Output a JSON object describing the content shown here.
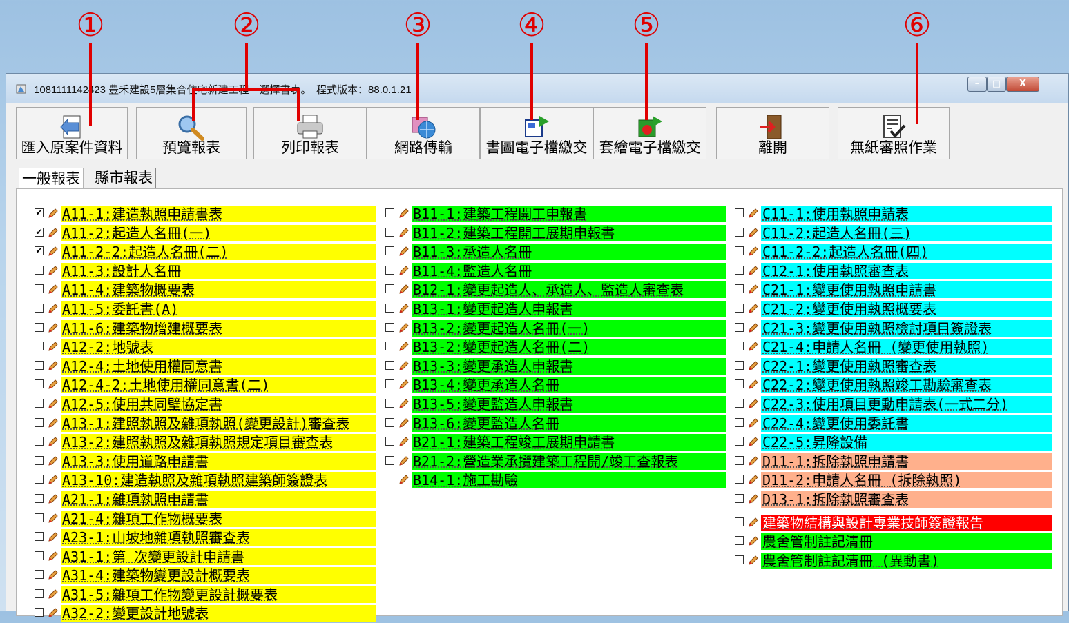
{
  "callouts": [
    "①",
    "②",
    "③",
    "④",
    "⑤",
    "⑥"
  ],
  "window": {
    "title": "1081111142423 豊禾建設5層集合住宅新建工程　選擇書表。　程式版本：88.0.1.21",
    "minimize": "–",
    "maximize": "□",
    "close": "X"
  },
  "toolbar": {
    "import_label": "匯入原案件資料",
    "preview_label": "預覽報表",
    "print_label": "列印報表",
    "network_label": "網路傳輸",
    "drawing_label": "書圖電子檔繳交",
    "overlay_label": "套繪電子檔繳交",
    "exit_label": "離開",
    "paperless_label": "無紙審照作業"
  },
  "tabs": [
    "一般報表",
    "縣市報表"
  ],
  "colors": {
    "yellow": "#ffff00",
    "green": "#00ff00",
    "cyan": "#00ffff",
    "salmon": "#ffb08c",
    "red": "#ff0000"
  },
  "columns": [
    {
      "items": [
        {
          "label": "A11-1:建造執照申請書表",
          "checked": true,
          "color": "yellow",
          "checkbox": true
        },
        {
          "label": "A11-2:起造人名冊(一)",
          "checked": true,
          "color": "yellow",
          "checkbox": true
        },
        {
          "label": "A11-2-2:起造人名冊(二)",
          "checked": true,
          "color": "yellow",
          "checkbox": true
        },
        {
          "label": "A11-3:設計人名冊",
          "checked": false,
          "color": "yellow",
          "checkbox": true
        },
        {
          "label": "A11-4:建築物概要表",
          "checked": false,
          "color": "yellow",
          "checkbox": true
        },
        {
          "label": "A11-5:委託書(A)",
          "checked": false,
          "color": "yellow",
          "checkbox": true
        },
        {
          "label": "A11-6:建築物增建概要表",
          "checked": false,
          "color": "yellow",
          "checkbox": true
        },
        {
          "label": "A12-2:地號表",
          "checked": false,
          "color": "yellow",
          "checkbox": true
        },
        {
          "label": "A12-4:土地使用權同意書",
          "checked": false,
          "color": "yellow",
          "checkbox": true
        },
        {
          "label": "A12-4-2:土地使用權同意書(二)",
          "checked": false,
          "color": "yellow",
          "checkbox": true
        },
        {
          "label": "A12-5:使用共同壁協定書",
          "checked": false,
          "color": "yellow",
          "checkbox": true
        },
        {
          "label": "A13-1:建照執照及雜項執照(變更設計)審查表",
          "checked": false,
          "color": "yellow",
          "checkbox": true
        },
        {
          "label": "A13-2:建照執照及雜項執照規定項目審查表",
          "checked": false,
          "color": "yellow",
          "checkbox": true
        },
        {
          "label": "A13-3:使用道路申請書",
          "checked": false,
          "color": "yellow",
          "checkbox": true
        },
        {
          "label": "A13-10:建造執照及雜項執照建築師簽證表",
          "checked": false,
          "color": "yellow",
          "checkbox": true
        },
        {
          "label": "A21-1:雜項執照申請書",
          "checked": false,
          "color": "yellow",
          "checkbox": true
        },
        {
          "label": "A21-4:雜項工作物概要表",
          "checked": false,
          "color": "yellow",
          "checkbox": true
        },
        {
          "label": "A23-1:山坡地雜項執照審查表",
          "checked": false,
          "color": "yellow",
          "checkbox": true
        },
        {
          "label": "A31-1:第 次變更設計申請書",
          "checked": false,
          "color": "yellow",
          "checkbox": true
        },
        {
          "label": "A31-4:建築物變更設計概要表",
          "checked": false,
          "color": "yellow",
          "checkbox": true
        },
        {
          "label": "A31-5:雜項工作物變更設計概要表",
          "checked": false,
          "color": "yellow",
          "checkbox": true
        },
        {
          "label": "A32-2:變更設計地號表",
          "checked": false,
          "color": "yellow",
          "checkbox": true
        }
      ]
    },
    {
      "items": [
        {
          "label": "B11-1:建築工程開工申報書",
          "checked": false,
          "color": "green",
          "checkbox": true
        },
        {
          "label": "B11-2:建築工程開工展期申報書",
          "checked": false,
          "color": "green",
          "checkbox": true
        },
        {
          "label": "B11-3:承造人名冊",
          "checked": false,
          "color": "green",
          "checkbox": true
        },
        {
          "label": "B11-4:監造人名冊",
          "checked": false,
          "color": "green",
          "checkbox": true
        },
        {
          "label": "B12-1:變更起造人、承造人、監造人審查表",
          "checked": false,
          "color": "green",
          "checkbox": true
        },
        {
          "label": "B13-1:變更起造人申報書",
          "checked": false,
          "color": "green",
          "checkbox": true
        },
        {
          "label": "B13-2:變更起造人名冊(一)",
          "checked": false,
          "color": "green",
          "checkbox": true
        },
        {
          "label": "B13-2:變更起造人名冊(二)",
          "checked": false,
          "color": "green",
          "checkbox": true
        },
        {
          "label": "B13-3:變更承造人申報書",
          "checked": false,
          "color": "green",
          "checkbox": true
        },
        {
          "label": "B13-4:變更承造人名冊",
          "checked": false,
          "color": "green",
          "checkbox": true
        },
        {
          "label": "B13-5:變更監造人申報書",
          "checked": false,
          "color": "green",
          "checkbox": true
        },
        {
          "label": "B13-6:變更監造人名冊",
          "checked": false,
          "color": "green",
          "checkbox": true
        },
        {
          "label": "B21-1:建築工程竣工展期申請書",
          "checked": false,
          "color": "green",
          "checkbox": true
        },
        {
          "label": "B21-2:營造業承攬建築工程開/竣工查報表",
          "checked": false,
          "color": "green",
          "checkbox": true
        },
        {
          "label": "B14-1:施工勘驗",
          "checked": false,
          "color": "green",
          "checkbox": false
        }
      ]
    },
    {
      "items": [
        {
          "label": "C11-1:使用執照申請表",
          "checked": false,
          "color": "cyan",
          "checkbox": true
        },
        {
          "label": "C11-2:起造人名冊(三)",
          "checked": false,
          "color": "cyan",
          "checkbox": true
        },
        {
          "label": "C11-2-2:起造人名冊(四)",
          "checked": false,
          "color": "cyan",
          "checkbox": true
        },
        {
          "label": "C12-1:使用執照審查表",
          "checked": false,
          "color": "cyan",
          "checkbox": true
        },
        {
          "label": "C21-1:變更使用執照申請書",
          "checked": false,
          "color": "cyan",
          "checkbox": true
        },
        {
          "label": "C21-2:變更使用執照概要表",
          "checked": false,
          "color": "cyan",
          "checkbox": true
        },
        {
          "label": "C21-3:變更使用執照檢討項目簽證表",
          "checked": false,
          "color": "cyan",
          "checkbox": true
        },
        {
          "label": "C21-4:申請人名冊 (變更使用執照)",
          "checked": false,
          "color": "cyan",
          "checkbox": true
        },
        {
          "label": "C22-1:變更使用執照審查表",
          "checked": false,
          "color": "cyan",
          "checkbox": true
        },
        {
          "label": "C22-2:變更使用執照竣工勘驗審查表",
          "checked": false,
          "color": "cyan",
          "checkbox": true
        },
        {
          "label": "C22-3:使用項目更動申請表(一式二分)",
          "checked": false,
          "color": "cyan",
          "checkbox": true
        },
        {
          "label": "C22-4:變更使用委託書",
          "checked": false,
          "color": "cyan",
          "checkbox": true
        },
        {
          "label": "C22-5:昇降設備",
          "checked": false,
          "color": "cyan",
          "checkbox": true
        },
        {
          "label": "D11-1:拆除執照申請書",
          "checked": false,
          "color": "salmon",
          "checkbox": true
        },
        {
          "label": "D11-2:申請人名冊 (拆除執照)",
          "checked": false,
          "color": "salmon",
          "checkbox": true
        },
        {
          "label": "D13-1:拆除執照審查表",
          "checked": false,
          "color": "salmon",
          "checkbox": true
        },
        {
          "label": "建築物結構與設計專業技師簽證報告",
          "checked": false,
          "color": "red",
          "checkbox": true
        },
        {
          "label": "農舍管制註記清冊",
          "checked": false,
          "color": "green",
          "checkbox": true
        },
        {
          "label": "農舍管制註記清冊 (異動書)",
          "checked": false,
          "color": "green",
          "checkbox": true
        }
      ]
    }
  ]
}
